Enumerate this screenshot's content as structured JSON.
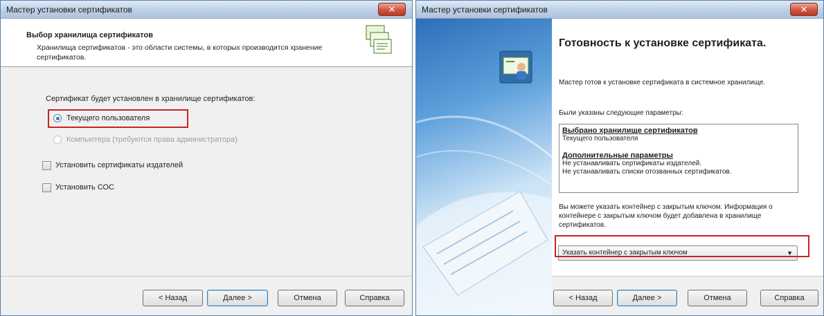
{
  "left_dialog": {
    "title": "Мастер установки сертификатов",
    "close_label": "✕",
    "header_title": "Выбор хранилища сертификатов",
    "header_desc": "Хранилища сертификатов - это области системы, в которых производится хранение сертификатов.",
    "store_label": "Сертификат будет установлен в хранилище сертификатов:",
    "radio_user": "Текущего пользователя",
    "radio_computer": "Компьютера (требуются права администратора)",
    "check_publishers": "Установить сертификаты издателей",
    "check_crl": "Установить СОС",
    "buttons": {
      "back": "< Назад",
      "next": "Далее >",
      "cancel": "Отмена",
      "help": "Справка"
    }
  },
  "right_dialog": {
    "title": "Мастер установки сертификатов",
    "close_label": "✕",
    "heading": "Готовность к установке сертификата.",
    "ready_text": "Мастер готов к установке сертификата в системное хранилище.",
    "params_label": "Были указаны следующие параметры:",
    "summary": {
      "store_section": "Выбрано хранилище сертификатов",
      "store_value": "Текущего пользователя",
      "extra_section": "Дополнительные параметры",
      "extra_line1": "Не устанавливать сертификаты издателей.",
      "extra_line2": "Не устанавливать списки отозванных сертификатов."
    },
    "container_text": "Вы можете указать контейнер с закрытым ключом. Информация о контейнере с закрытым ключом будет добавлена в хранилище сертификатов.",
    "dropdown_value": "Указать контейнер с закрытым ключом",
    "buttons": {
      "back": "< Назад",
      "next": "Далее >",
      "cancel": "Отмена",
      "help": "Справка"
    }
  },
  "colors": {
    "highlight": "#c92222",
    "accent": "#3c7fb1"
  }
}
